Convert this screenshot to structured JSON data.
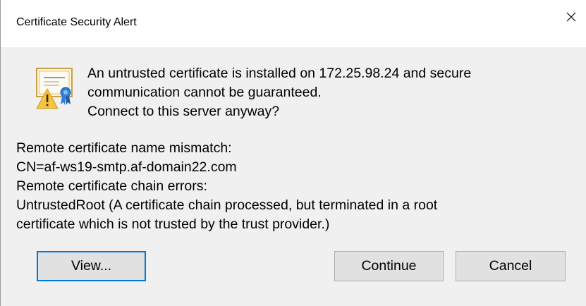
{
  "window": {
    "title": "Certificate Security Alert",
    "close_icon": "close-icon"
  },
  "icon": "certificate-warning-icon",
  "message": {
    "line1": "An untrusted certificate is installed on 172.25.98.24 and secure",
    "line2": "communication cannot be guaranteed.",
    "line3": "Connect to this server anyway?"
  },
  "details": {
    "line1": "Remote certificate name mismatch:",
    "line2": "CN=af-ws19-smtp.af-domain22.com",
    "line3": "Remote certificate chain errors:",
    "line4": "UntrustedRoot (A certificate chain processed, but terminated in a root",
    "line5": "certificate which is not trusted by the trust provider.)"
  },
  "buttons": {
    "view": "View...",
    "continue": "Continue",
    "cancel": "Cancel"
  },
  "colors": {
    "focus_border": "#0078d7",
    "warning_yellow": "#f5c342",
    "ribbon_blue": "#2f7fd8"
  }
}
